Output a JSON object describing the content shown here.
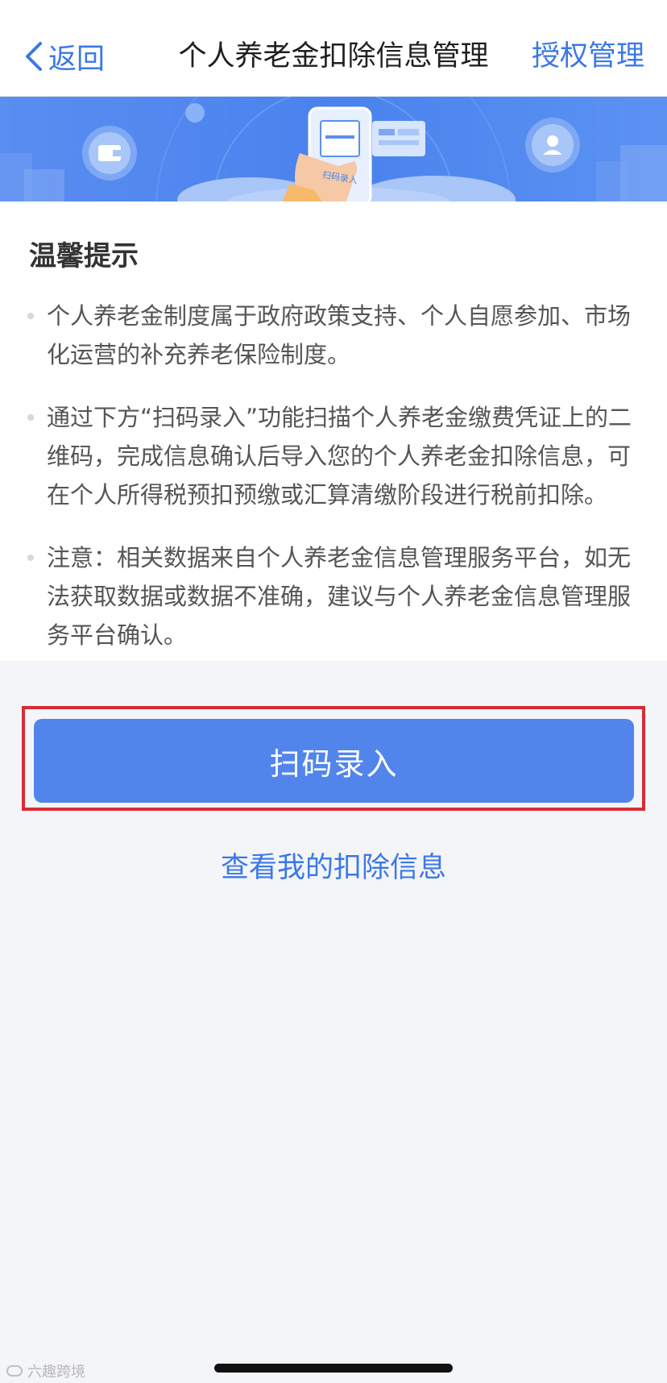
{
  "nav": {
    "back_label": "返回",
    "title": "个人养老金扣除信息管理",
    "right_action": "授权管理"
  },
  "banner": {
    "phone_label": "扫码录入"
  },
  "tips": {
    "title": "温馨提示",
    "items": [
      "个人养老金制度属于政府政策支持、个人自愿参加、市场化运营的补充养老保险制度。",
      "通过下方“扫码录入”功能扫描个人养老金缴费凭证上的二维码，完成信息确认后导入您的个人养老金扣除信息，可在个人所得税预扣预缴或汇算清缴阶段进行税前扣除。",
      "注意：相关数据来自个人养老金信息管理服务平台，如无法获取数据或数据不准确，建议与个人养老金信息管理服务平台确认。"
    ]
  },
  "actions": {
    "scan_button": "扫码录入",
    "view_link": "查看我的扣除信息"
  },
  "watermark": "六趣跨境",
  "colors": {
    "accent": "#3b78e7",
    "button": "#5285ec",
    "highlight": "#d72c35"
  }
}
